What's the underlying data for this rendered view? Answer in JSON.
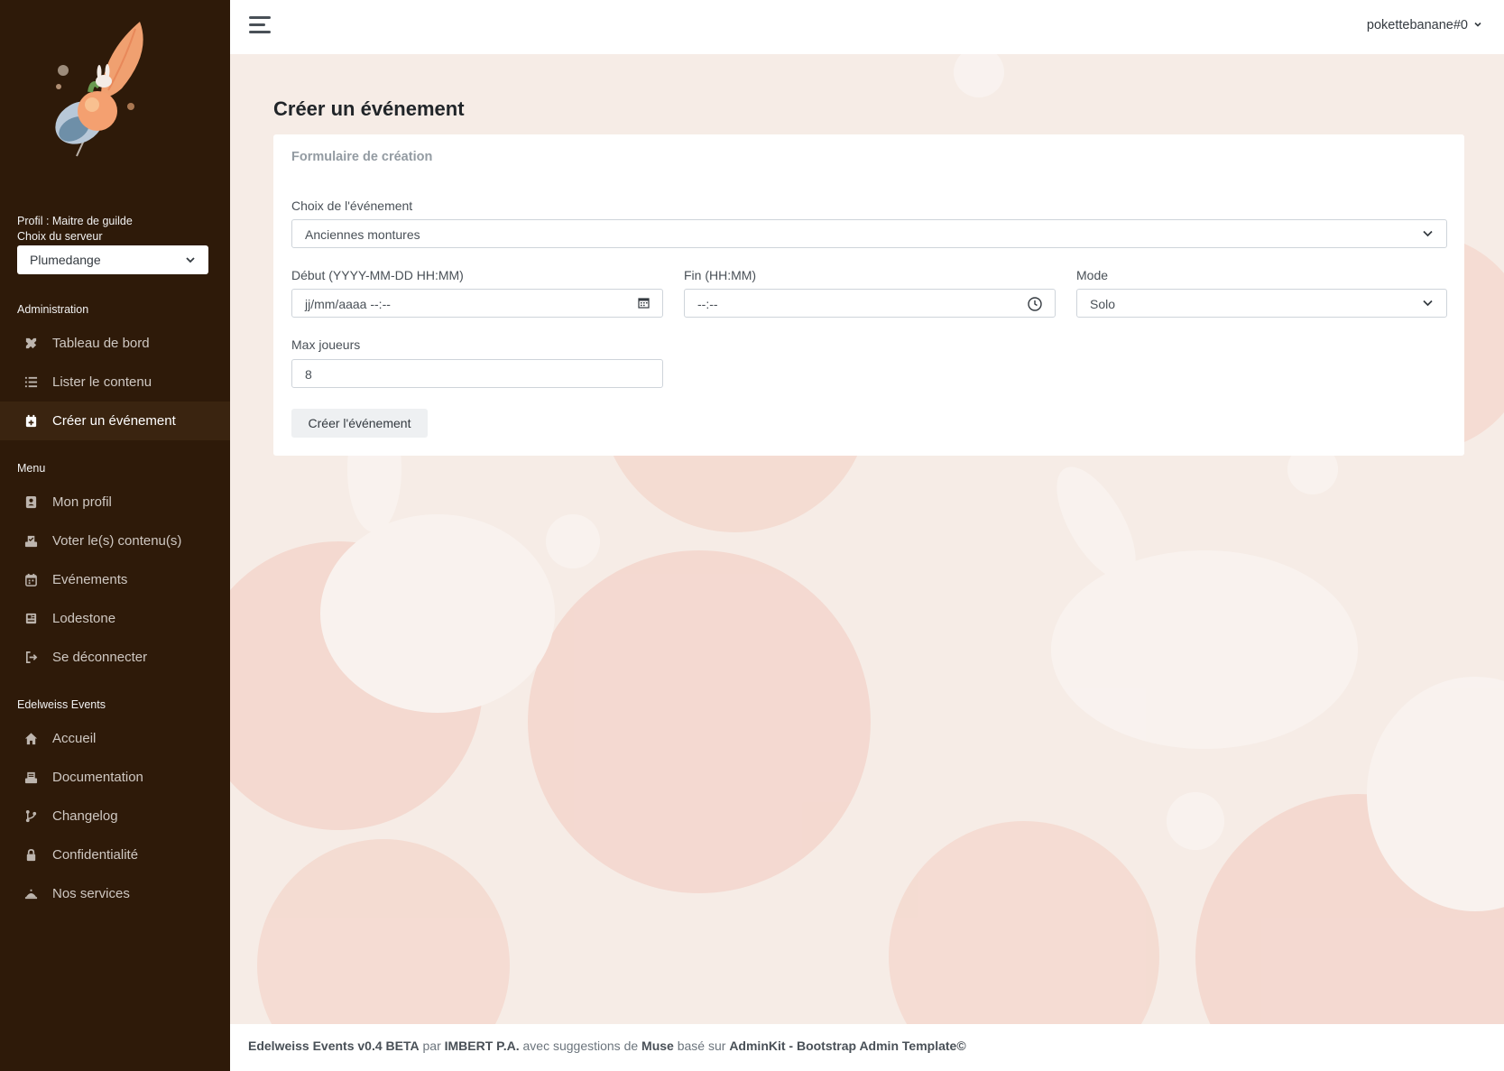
{
  "sidebar": {
    "profile_label": "Profil : Maitre de guilde",
    "server_label": "Choix du serveur",
    "server_value": "Plumedange",
    "sections": [
      {
        "header": "Administration",
        "items": [
          {
            "label": "Tableau de bord",
            "icon": "tools-icon"
          },
          {
            "label": "Lister le contenu",
            "icon": "list-icon"
          },
          {
            "label": "Créer un événement",
            "icon": "calendar-plus-icon",
            "active": true
          }
        ]
      },
      {
        "header": "Menu",
        "items": [
          {
            "label": "Mon profil",
            "icon": "id-card-icon"
          },
          {
            "label": "Voter le(s) contenu(s)",
            "icon": "vote-icon"
          },
          {
            "label": "Evénements",
            "icon": "calendar-icon"
          },
          {
            "label": "Lodestone",
            "icon": "newspaper-icon"
          },
          {
            "label": "Se déconnecter",
            "icon": "logout-icon"
          }
        ]
      },
      {
        "header": "Edelweiss Events",
        "items": [
          {
            "label": "Accueil",
            "icon": "home-icon"
          },
          {
            "label": "Documentation",
            "icon": "book-icon"
          },
          {
            "label": "Changelog",
            "icon": "git-icon"
          },
          {
            "label": "Confidentialité",
            "icon": "lock-icon"
          },
          {
            "label": "Nos services",
            "icon": "services-icon"
          }
        ]
      }
    ]
  },
  "topbar": {
    "username": "pokettebanane#0"
  },
  "page": {
    "title": "Créer un événement",
    "card_title": "Formulaire de création",
    "event_choice_label": "Choix de l'événement",
    "event_choice_value": "Anciennes montures",
    "start_label": "Début (YYYY-MM-DD HH:MM)",
    "start_placeholder": "jj/mm/aaaa --:--",
    "end_label": "Fin (HH:MM)",
    "end_placeholder": "--:--",
    "mode_label": "Mode",
    "mode_value": "Solo",
    "max_players_label": "Max joueurs",
    "max_players_value": "8",
    "submit_label": "Créer l'événement"
  },
  "footer": {
    "app": "Edelweiss Events v0.4 BETA",
    "par": "par",
    "author": "IMBERT P.A.",
    "suggest": "avec suggestions de",
    "muse": "Muse",
    "based": "basé sur",
    "template": "AdminKit - Bootstrap Admin Template©"
  },
  "colors": {
    "sidebar_bg": "#2e1a09",
    "sidebar_active_bg": "#3a2410",
    "main_bg": "#f6ece6"
  }
}
